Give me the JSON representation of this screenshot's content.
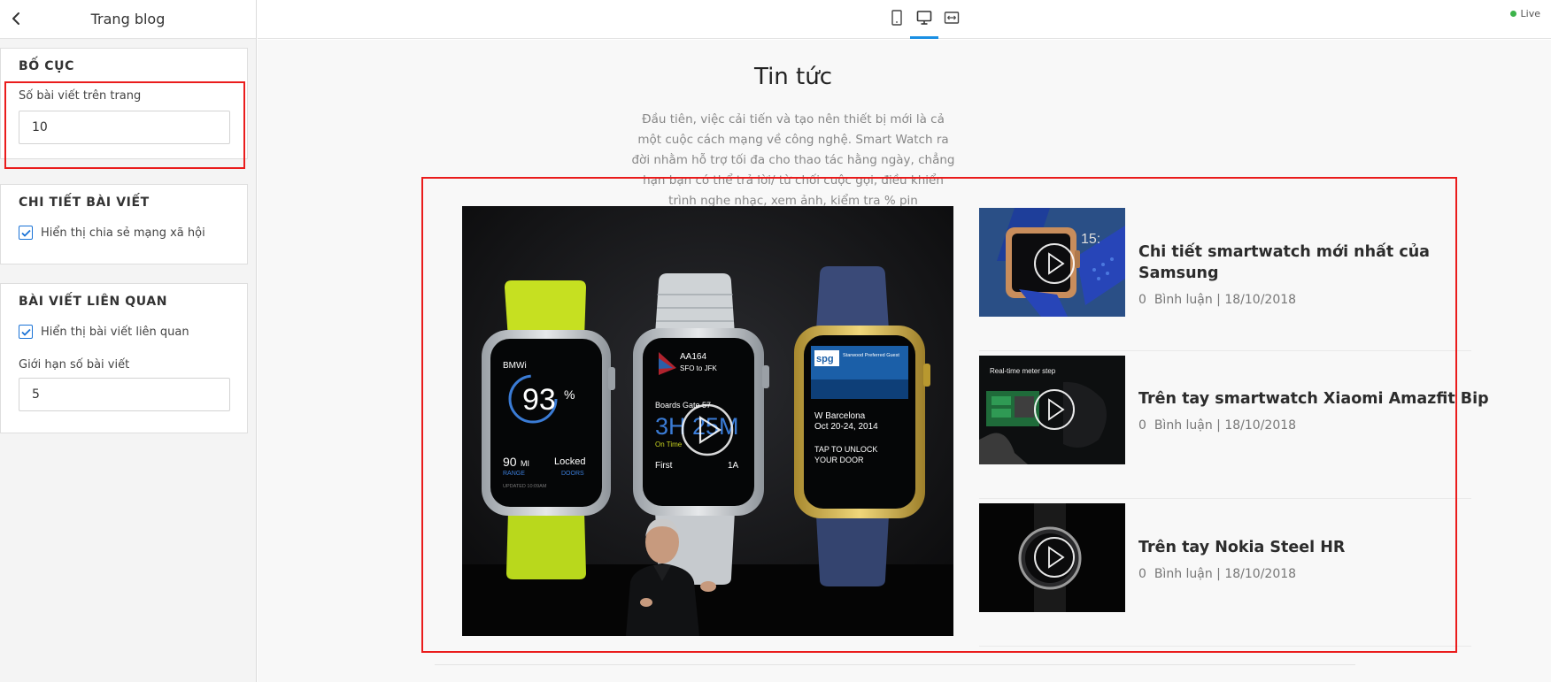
{
  "sidebar": {
    "title": "Trang blog",
    "layout": {
      "heading": "BỐ CỤC",
      "posts_per_page_label": "Số bài viết trên trang",
      "posts_per_page_value": "10"
    },
    "post_detail": {
      "heading": "CHI TIẾT BÀI VIẾT",
      "show_social_share_label": "Hiển thị chia sẻ mạng xã hội",
      "show_social_share_checked": true
    },
    "related_posts": {
      "heading": "BÀI VIẾT LIÊN QUAN",
      "show_related_label": "Hiển thị bài viết liên quan",
      "show_related_checked": true,
      "limit_label": "Giới hạn số bài viết",
      "limit_value": "5"
    }
  },
  "topbar": {
    "devices": [
      "mobile-icon",
      "desktop-icon",
      "fullwidth-icon"
    ],
    "active_device": "desktop-icon",
    "status": "Live",
    "status_color": "#3cb34a"
  },
  "preview": {
    "title": "Tin tức",
    "description": "Đầu tiên, việc cải tiến và tạo nên thiết bị mới là cả một cuộc cách mạng về công nghệ. Smart Watch ra đời nhằm hỗ trợ tối đa cho thao tác hằng ngày, chẳng hạn bạn có thể trả lời/ từ chối cuộc gọi, điều khiển trình nghe nhạc, xem ảnh, kiểm tra % pin smartphone, xem thông báo.....",
    "featured": {
      "watch1": {
        "brand": "BMWi",
        "percent": "93",
        "percent_unit": "%",
        "range_value": "90",
        "range_unit": "MI",
        "range_label": "RANGE",
        "lock_top": "Locked",
        "lock_label": "DOORS",
        "updated": "UPDATED 10:09AM"
      },
      "watch2": {
        "flight": "AA164",
        "route": "SFO to JFK",
        "gate": "Boards Gate 57",
        "time": "3H 25M",
        "status": "On Time",
        "first": "First",
        "seat": "1A"
      },
      "watch3": {
        "logo": "spg",
        "logo_sub": "Starwood Preferred Guest",
        "city": "W Barcelona",
        "dates": "Oct 20-24, 2014",
        "tap1": "TAP TO UNLOCK",
        "tap2": "YOUR DOOR"
      }
    },
    "posts": [
      {
        "title": "Chi tiết smartwatch mới nhất của Samsung",
        "comments": "0",
        "comments_label": "Bình luận",
        "date": "18/10/2018"
      },
      {
        "title": "Trên tay smartwatch Xiaomi Amazfit Bip",
        "comments": "0",
        "comments_label": "Bình luận",
        "date": "18/10/2018",
        "thumb_caption": "Real-time meter step"
      },
      {
        "title": "Trên tay Nokia Steel HR",
        "comments": "0",
        "comments_label": "Bình luận",
        "date": "18/10/2018"
      }
    ]
  },
  "colors": {
    "highlight": "#ea1c1c",
    "accent": "#1a8fe3",
    "checkbox": "#1a73d6"
  }
}
